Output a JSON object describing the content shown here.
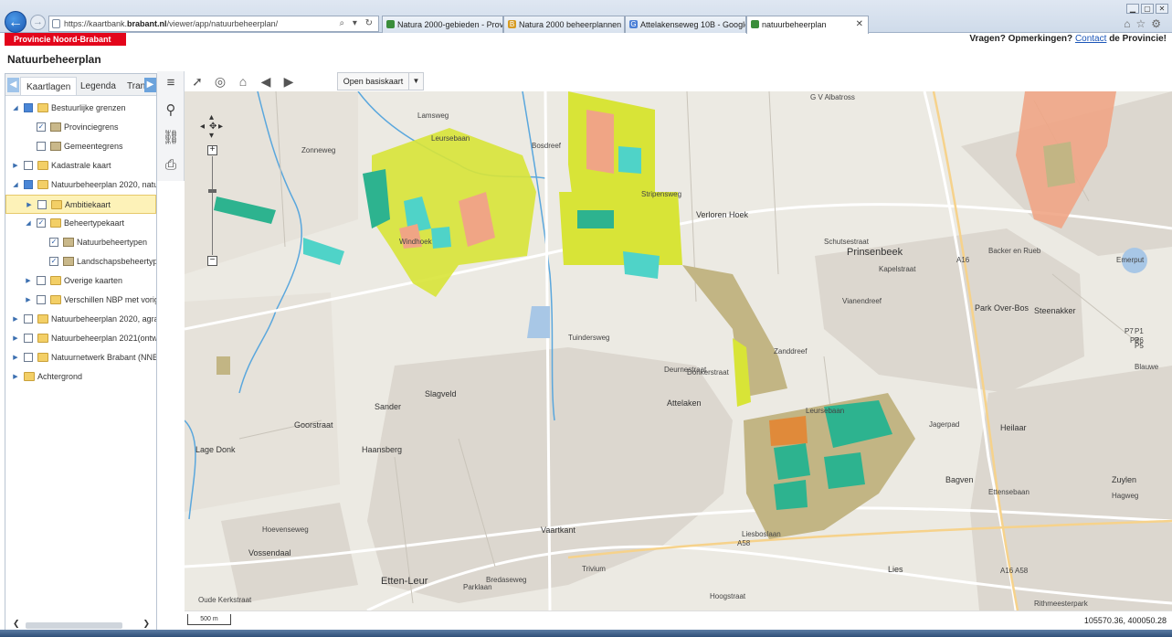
{
  "browser": {
    "url_prefix": "https://kaartbank.",
    "url_domain": "brabant.nl",
    "url_path": "/viewer/app/natuurbeheerplan/",
    "address_tools": "⌕ ▾ ↻",
    "tabs": [
      {
        "label": "Natura 2000-gebieden - Provi...",
        "icon": "leaf-icon",
        "color": "#3a8d3a"
      },
      {
        "label": "Natura 2000 beheerplannen - ...",
        "icon": "bb-icon",
        "color": "#d69b22"
      },
      {
        "label": "Attelakenseweg 10B - Google ...",
        "icon": "google-icon",
        "color": "#4a7fd6"
      },
      {
        "label": "natuurbeheerplan",
        "icon": "leaf-icon",
        "color": "#3a8d3a"
      }
    ],
    "close_symbol": "✕"
  },
  "header": {
    "brand": "Provincie Noord-Brabant",
    "contact_prefix": "Vragen? Opmerkingen?",
    "contact_link": "Contact",
    "contact_suffix": "de Provincie!",
    "title": "Natuurbeheerplan"
  },
  "panel": {
    "tabs": [
      "Kaartlagen",
      "Legenda",
      "Tran"
    ],
    "tree": [
      {
        "label": "Bestuurlijke grenzen",
        "level": 0,
        "expanded": true,
        "check": "partial",
        "icon": "folder"
      },
      {
        "label": "Provinciegrens",
        "level": 1,
        "expanded": null,
        "check": "checked",
        "icon": "layer"
      },
      {
        "label": "Gemeentegrens",
        "level": 1,
        "expanded": null,
        "check": "unchecked",
        "icon": "layer"
      },
      {
        "label": "Kadastrale kaart",
        "level": 0,
        "expanded": false,
        "check": "unchecked",
        "icon": "folder"
      },
      {
        "label": "Natuurbeheerplan 2020, natu",
        "level": 0,
        "expanded": true,
        "check": "partial",
        "icon": "folder"
      },
      {
        "label": "Ambitiekaart",
        "level": 1,
        "expanded": false,
        "check": "unchecked",
        "icon": "folder",
        "selected": true
      },
      {
        "label": "Beheertypekaart",
        "level": 1,
        "expanded": true,
        "check": "checked",
        "icon": "folder"
      },
      {
        "label": "Natuurbeheertypen",
        "level": 2,
        "expanded": null,
        "check": "checked",
        "icon": "layer"
      },
      {
        "label": "Landschapsbeheertyp",
        "level": 2,
        "expanded": null,
        "check": "checked",
        "icon": "layer"
      },
      {
        "label": "Overige kaarten",
        "level": 1,
        "expanded": false,
        "check": "unchecked",
        "icon": "folder"
      },
      {
        "label": "Verschillen NBP met vorig",
        "level": 1,
        "expanded": false,
        "check": "unchecked",
        "icon": "folder"
      },
      {
        "label": "Natuurbeheerplan 2020, agra",
        "level": 0,
        "expanded": false,
        "check": "unchecked",
        "icon": "folder"
      },
      {
        "label": "Natuurbeheerplan 2021(ontw",
        "level": 0,
        "expanded": false,
        "check": "unchecked",
        "icon": "folder"
      },
      {
        "label": "Natuurnetwerk Brabant (NNB",
        "level": 0,
        "expanded": false,
        "check": "unchecked",
        "icon": "folder"
      },
      {
        "label": "Achtergrond",
        "level": 0,
        "expanded": false,
        "check": null,
        "icon": "folder"
      }
    ]
  },
  "toolbar": {
    "basemap_label": "Open basiskaart",
    "basemap_dropdown": "▼"
  },
  "map": {
    "labels": [
      {
        "text": "Lamsweg",
        "cls": "road"
      },
      {
        "text": "Leursebaan",
        "cls": "road"
      },
      {
        "text": "Bosdreef",
        "cls": "road"
      },
      {
        "text": "Zonneweg",
        "cls": "road"
      },
      {
        "text": "Windhoek",
        "cls": "road"
      },
      {
        "text": "Stripensweg",
        "cls": "road"
      },
      {
        "text": "Verloren Hoek",
        "cls": "town"
      },
      {
        "text": "Prinsenbeek",
        "cls": "big"
      },
      {
        "text": "Schutsestraat",
        "cls": "road"
      },
      {
        "text": "Kapelstraat",
        "cls": "road"
      },
      {
        "text": "Backer en Rueb",
        "cls": "road"
      },
      {
        "text": "Emerput",
        "cls": "road"
      },
      {
        "text": "Steenakker",
        "cls": "town"
      },
      {
        "text": "Park Over-Bos",
        "cls": "town"
      },
      {
        "text": "Vianendreef",
        "cls": "road"
      },
      {
        "text": "Zanddreef",
        "cls": "road"
      },
      {
        "text": "Tuindersweg",
        "cls": "road"
      },
      {
        "text": "Donkerstraat",
        "cls": "road"
      },
      {
        "text": "Deurnestraat",
        "cls": "road"
      },
      {
        "text": "Attelaken",
        "cls": "town"
      },
      {
        "text": "Slagveld",
        "cls": "town"
      },
      {
        "text": "Sander",
        "cls": "town"
      },
      {
        "text": "Goorstraat",
        "cls": "town"
      },
      {
        "text": "Lage Donk",
        "cls": "town"
      },
      {
        "text": "Haansberg",
        "cls": "town"
      },
      {
        "text": "Leursebaan",
        "cls": "road"
      },
      {
        "text": "Jagerpad",
        "cls": "road"
      },
      {
        "text": "Bagven",
        "cls": "town"
      },
      {
        "text": "Heilaar",
        "cls": "town"
      },
      {
        "text": "Zuylen",
        "cls": "town"
      },
      {
        "text": "Ettensebaan",
        "cls": "road"
      },
      {
        "text": "Hagweg",
        "cls": "road"
      },
      {
        "text": "Vaartkant",
        "cls": "town"
      },
      {
        "text": "Vossendaal",
        "cls": "town"
      },
      {
        "text": "Etten-Leur",
        "cls": "big"
      },
      {
        "text": "Hoevenseweg",
        "cls": "road"
      },
      {
        "text": "Liesboslaan",
        "cls": "road"
      },
      {
        "text": "Bredaseweg",
        "cls": "road"
      },
      {
        "text": "Trivium",
        "cls": "road"
      },
      {
        "text": "Parklaan",
        "cls": "road"
      },
      {
        "text": "Lies",
        "cls": "town"
      },
      {
        "text": "Hoogstraat",
        "cls": "road"
      },
      {
        "text": "Rithmeesterpark",
        "cls": "road"
      },
      {
        "text": "Oude Kerkstraat",
        "cls": "road"
      },
      {
        "text": "A16",
        "cls": "road"
      },
      {
        "text": "A58",
        "cls": "road"
      },
      {
        "text": "A16 A58",
        "cls": "road"
      },
      {
        "text": "G V Albatross",
        "cls": "road"
      },
      {
        "text": "Blauwe",
        "cls": "road"
      },
      {
        "text": "P7",
        "cls": "road"
      },
      {
        "text": "P1",
        "cls": "road"
      },
      {
        "text": "P3",
        "cls": "road"
      },
      {
        "text": "P6",
        "cls": "road"
      },
      {
        "text": "P5",
        "cls": "road"
      }
    ],
    "scale": "500 m",
    "coords": "105570.36, 400050.28"
  },
  "colors": {
    "brand_red": "#e3051b",
    "nature_yellow": "#d8e437",
    "nature_teal": "#2db38f",
    "nature_salmon": "#f0a585",
    "nature_olive": "#c2b584"
  }
}
